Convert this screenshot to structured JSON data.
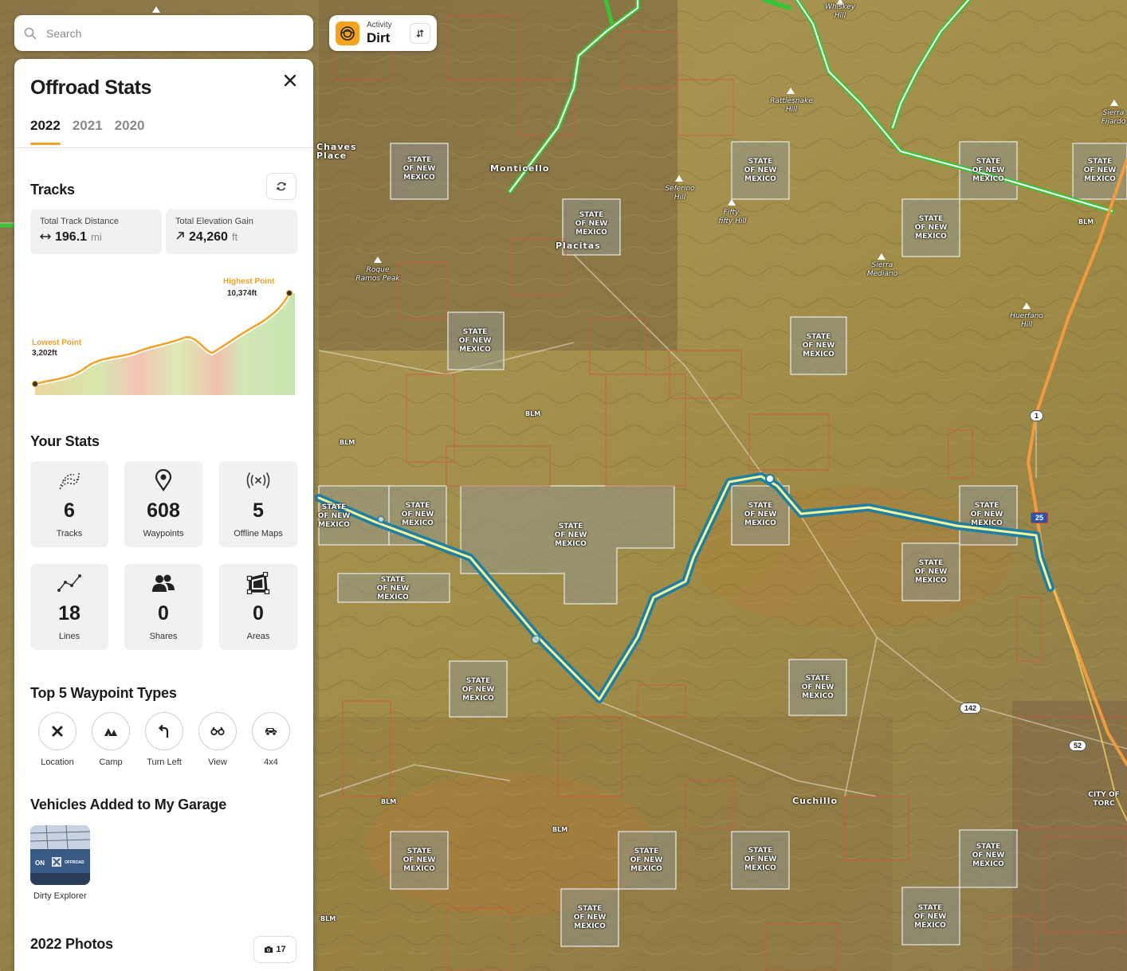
{
  "search": {
    "placeholder": "Search"
  },
  "activity": {
    "label": "Activity",
    "value": "Dirt"
  },
  "panel": {
    "title": "Offroad Stats",
    "tabs": [
      "2022",
      "2021",
      "2020"
    ],
    "tracks": {
      "title": "Tracks",
      "distance_label": "Total Track Distance",
      "distance_value": "196.1",
      "distance_unit": "mi",
      "gain_label": "Total Elevation Gain",
      "gain_value": "24,260",
      "gain_unit": "ft"
    },
    "elevation": {
      "lowest_label": "Lowest Point",
      "lowest_value": "3,202ft",
      "highest_label": "Highest Point",
      "highest_value": "10,374ft"
    },
    "your_stats": {
      "title": "Your Stats",
      "cards": [
        {
          "value": "6",
          "label": "Tracks",
          "icon": "tracks-icon"
        },
        {
          "value": "608",
          "label": "Waypoints",
          "icon": "map-pin-icon"
        },
        {
          "value": "5",
          "label": "Offline Maps",
          "icon": "offline-maps-icon"
        },
        {
          "value": "18",
          "label": "Lines",
          "icon": "line-icon"
        },
        {
          "value": "0",
          "label": "Shares",
          "icon": "users-icon"
        },
        {
          "value": "0",
          "label": "Areas",
          "icon": "area-icon"
        }
      ]
    },
    "waypoint_types": {
      "title": "Top 5 Waypoint Types",
      "items": [
        {
          "label": "Location",
          "icon": "x-marker-icon"
        },
        {
          "label": "Camp",
          "icon": "camp-icon"
        },
        {
          "label": "Turn Left",
          "icon": "turn-left-icon"
        },
        {
          "label": "View",
          "icon": "binoculars-icon"
        },
        {
          "label": "4x4",
          "icon": "4x4-icon"
        }
      ]
    },
    "garage": {
      "title": "Vehicles Added to My Garage",
      "vehicle_name": "Dirty Explorer",
      "thumb_text": "ON X OFFROAD"
    },
    "photos": {
      "title": "2022 Photos",
      "count": "17"
    }
  },
  "map": {
    "places": {
      "monticello": "Monticello",
      "placitas": "Placitas",
      "chaves": "Chaves Place",
      "cuchillo": "Cuchillo",
      "rattlesnake": "Rattlesnake Hill",
      "whiskey": "Whiskey Hill",
      "seferino": "Seferino Hill",
      "fiftyfifty": "Fifty-fifty Hill",
      "roque": "Roque Ramos Peak",
      "sierra_mediano": "Sierra Mediano",
      "huerfano": "Huerfano Hill",
      "sierra_fijardo": "Sierra Fijardo",
      "torc": "CITY OF TORC",
      "state_land": "STATE OF NEW MEXICO",
      "blm": "BLM"
    },
    "roads": [
      "1",
      "25",
      "142",
      "52"
    ],
    "colors": {
      "accent": "#f0a126",
      "route_green": "#39c337",
      "track_blue": "#1f7fa3",
      "track_highlight": "#f4f59a",
      "parcel_border": "#d8503f"
    }
  }
}
